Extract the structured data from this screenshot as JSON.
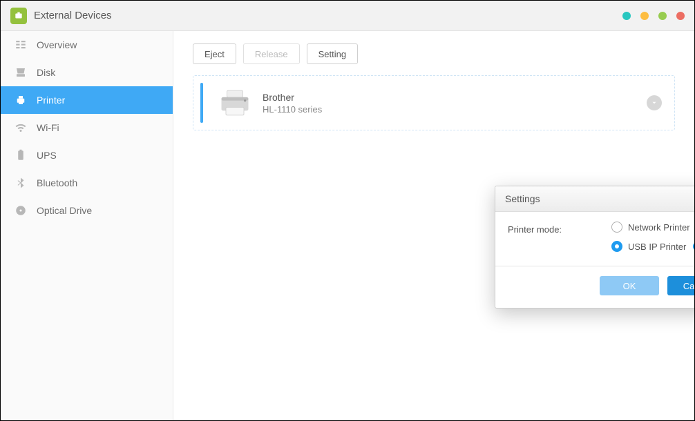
{
  "titlebar": {
    "title": "External Devices"
  },
  "sidebar": {
    "items": [
      {
        "label": "Overview"
      },
      {
        "label": "Disk"
      },
      {
        "label": "Printer"
      },
      {
        "label": "Wi-Fi"
      },
      {
        "label": "UPS"
      },
      {
        "label": "Bluetooth"
      },
      {
        "label": "Optical Drive"
      }
    ],
    "active_index": 2
  },
  "toolbar": {
    "eject_label": "Eject",
    "release_label": "Release",
    "setting_label": "Setting"
  },
  "device": {
    "name": "Brother",
    "model": "HL-1110 series"
  },
  "modal": {
    "title": "Settings",
    "form": {
      "printer_mode_label": "Printer mode:",
      "options": [
        {
          "label": "Network Printer",
          "checked": false
        },
        {
          "label": "USB IP Printer",
          "checked": true,
          "has_info": true
        }
      ]
    },
    "ok_label": "OK",
    "cancel_label": "Cancel"
  },
  "colors": {
    "accent": "#3fa9f5",
    "primary_button": "#1d8fdb"
  }
}
